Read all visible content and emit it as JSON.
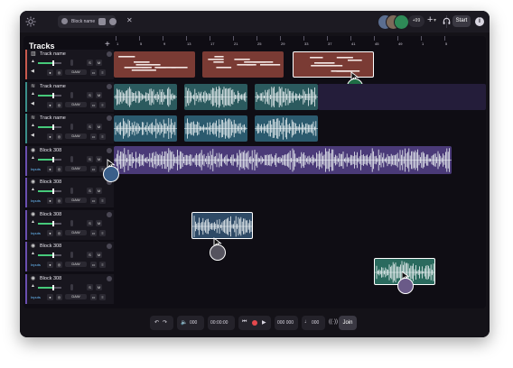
{
  "window": {
    "tab_name": "Block name",
    "avatar_count": "+99",
    "start_label": "Start",
    "info_label": "i"
  },
  "tracks_panel": {
    "title": "Tracks",
    "add_label": "+"
  },
  "ruler": [
    "1",
    "5",
    "9",
    "13",
    "17",
    "21",
    "25",
    "29",
    "33",
    "37",
    "41",
    "45",
    "49",
    "1",
    "5"
  ],
  "tracks": [
    {
      "name": "Track name",
      "icon": "piano-icon",
      "color": "#c95a4e",
      "daw": "DAW",
      "clip_color": "#7a3b34",
      "show_inputs": false
    },
    {
      "name": "Track name",
      "icon": "waveform-icon",
      "color": "#3b8f8a",
      "daw": "DAW",
      "clip_color": "#2b5a5e",
      "show_inputs": false
    },
    {
      "name": "Track name",
      "icon": "waveform-icon",
      "color": "#3b8f8a",
      "daw": "DAW",
      "clip_color": "#2b5a6e",
      "show_inputs": false
    },
    {
      "name": "Block 308",
      "icon": "block-icon",
      "color": "#6a4fb0",
      "daw": "DAW",
      "clip_color": "#4a3a78",
      "show_inputs": true,
      "inputs_label": "Inputs"
    },
    {
      "name": "Block 308",
      "icon": "block-icon",
      "color": "#6a4fb0",
      "daw": "DAW",
      "clip_color": "#2e4a66",
      "show_inputs": true,
      "inputs_label": "Inputs"
    },
    {
      "name": "Block 308",
      "icon": "block-icon",
      "color": "#6a4fb0",
      "daw": "DAW",
      "clip_color": "#2e4a66",
      "show_inputs": true,
      "inputs_label": "Inputs"
    },
    {
      "name": "Block 308",
      "icon": "block-icon",
      "color": "#6a4fb0",
      "daw": "DAW",
      "clip_color": "#2e4a66",
      "show_inputs": true,
      "inputs_label": "Inputs"
    },
    {
      "name": "Block 308",
      "icon": "block-icon",
      "color": "#6a4fb0",
      "daw": "DAW",
      "clip_color": "#2e4a66",
      "show_inputs": true,
      "inputs_label": "Inputs"
    }
  ],
  "mini_labels": {
    "s": "S",
    "m": "M"
  },
  "transport": {
    "undo_icon": "undo-icon",
    "redo_icon": "redo-icon",
    "volume_value": "000",
    "time_value": "00:00:00",
    "bpm_value": "000 000",
    "metronome_value": "000",
    "join_label": "Join"
  },
  "colors": {
    "accent_green": "#46c97a",
    "record_red": "#e5484d",
    "selected_border": "#ffffff"
  }
}
